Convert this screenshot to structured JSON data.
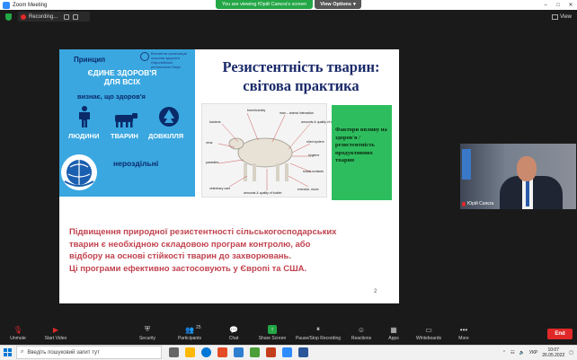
{
  "window": {
    "title": "Zoom Meeting"
  },
  "banner": {
    "viewing": "You are viewing Юрій Сапєга's screen",
    "view_options": "View Options"
  },
  "recording": {
    "label": "Recording..."
  },
  "view_button": {
    "label": "View"
  },
  "slide": {
    "who_text": "Всесвітня організація охорони здоров'я Європейське регіональне бюро",
    "principle": "Принцип",
    "one_health": "ЄДИНЕ ЗДОРОВ'Я ДЛЯ ВСІХ",
    "recognizes": "визнає, що здоров'я",
    "people": "ЛЮДИНИ",
    "animals": "ТВАРИН",
    "environment": "ДОВКІЛЛЯ",
    "inseparable": "нероздільні",
    "title": "Резистентність тварин: світова практика",
    "green_box": "Фактори впливу на здоров'я / резистентність продуктивних тварин",
    "diagram_labels": [
      "breed/variety",
      "man – animal interaction",
      "amounts & quality of water",
      "bacteria",
      "virus",
      "shed system",
      "hygiene",
      "parasites",
      "social contacts",
      "veterinary care",
      "amounts & quality of fodder",
      "exercise, move"
    ],
    "body_line1": "Підвищення природної резистентності сільськогосподарських",
    "body_line2": "тварин є необхідною складовою програм контролю, або",
    "body_line3": "відбору на основі стійкості тварин до захворювань.",
    "body_line4": "Ці програми ефективно застосовують у Європі та США.",
    "page_number": "2"
  },
  "video": {
    "name": "Юрій Сапєга"
  },
  "toolbar": {
    "unmute": "Unmute",
    "start_video": "Start Video",
    "security": "Security",
    "participants": "Participants",
    "participants_count": "25",
    "chat": "Chat",
    "share_screen": "Share Screen",
    "record": "Pause/Stop Recording",
    "reactions": "Reactions",
    "apps": "Apps",
    "whiteboards": "Whiteboards",
    "more": "More",
    "end": "End"
  },
  "taskbar": {
    "search_placeholder": "Введіть пошуковий запит тут",
    "language": "УКР",
    "time": "10:07",
    "date": "26.05.2022"
  }
}
